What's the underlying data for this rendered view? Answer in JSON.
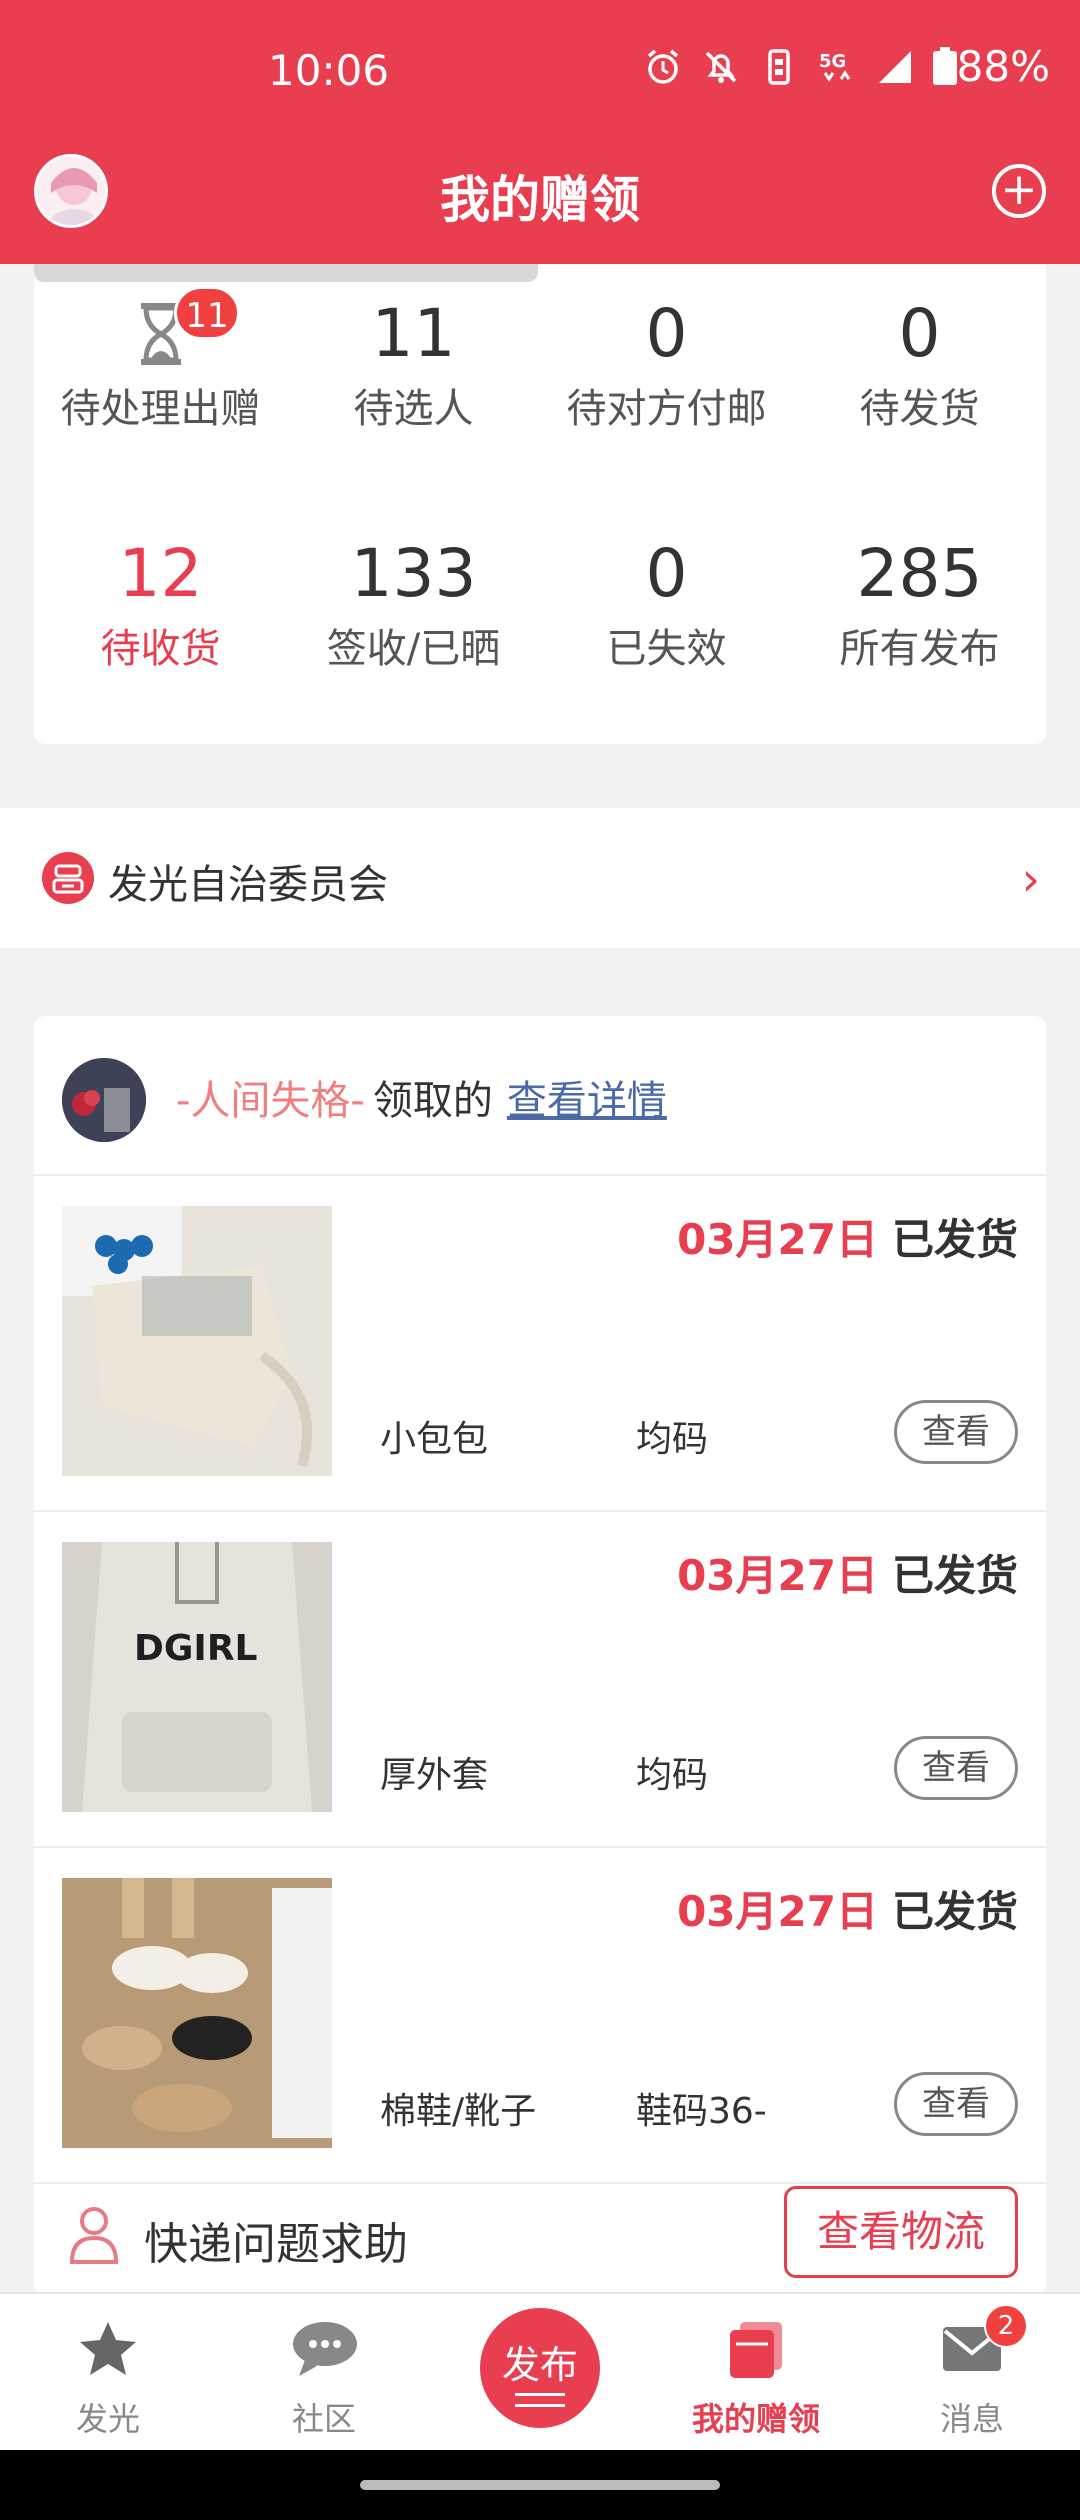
{
  "status_bar": {
    "time": "10:06",
    "battery": "88%"
  },
  "header": {
    "title": "我的赠领"
  },
  "stats": [
    {
      "value": "",
      "label": "待处理出赠",
      "badge": "11"
    },
    {
      "value": "11",
      "label": "待选人"
    },
    {
      "value": "0",
      "label": "待对方付邮"
    },
    {
      "value": "0",
      "label": "待发货"
    },
    {
      "value": "12",
      "label": "待收货"
    },
    {
      "value": "133",
      "label": "签收/已晒"
    },
    {
      "value": "0",
      "label": "已失效"
    },
    {
      "value": "285",
      "label": "所有发布"
    }
  ],
  "committee": {
    "label": "发光自治委员会"
  },
  "order": {
    "user_name": "-人间失格-",
    "action": "领取的",
    "details_link": "查看详情",
    "items": [
      {
        "date": "03月27日",
        "status": "已发货",
        "name": "小包包",
        "size": "均码",
        "view": "查看"
      },
      {
        "date": "03月27日",
        "status": "已发货",
        "name": "厚外套",
        "size": "均码",
        "view": "查看"
      },
      {
        "date": "03月27日",
        "status": "已发货",
        "name": "棉鞋/靴子",
        "size": "鞋码36-",
        "view": "查看"
      }
    ],
    "help_label": "快递问题求助",
    "logistics_button": "查看物流"
  },
  "nav": {
    "items": [
      {
        "label": "发光",
        "icon": "star-icon"
      },
      {
        "label": "社区",
        "icon": "chat-icon"
      },
      {
        "label": "发布",
        "icon": "publish-icon"
      },
      {
        "label": "我的赠领",
        "icon": "gift-box-icon"
      },
      {
        "label": "消息",
        "icon": "mail-icon",
        "badge": "2"
      }
    ]
  },
  "colors": {
    "brand": "#e83e50",
    "link": "#4b6aa8",
    "username": "#f08080"
  }
}
